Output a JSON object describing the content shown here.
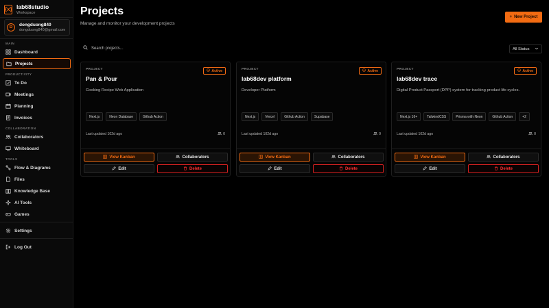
{
  "brand": {
    "logo": "{x}",
    "name": "lab68studio",
    "subtitle": "Workspace"
  },
  "user": {
    "initial": "D",
    "name": "dongduong840",
    "email": "dongduong840@gmail.com"
  },
  "sidebar": {
    "sections": {
      "main": "MAIN",
      "productivity": "PRODUCTIVITY",
      "collaboration": "COLLABORATION",
      "tools": "TOOLS"
    },
    "items": [
      {
        "label": "Dashboard",
        "icon": "grid-icon"
      },
      {
        "label": "Projects",
        "icon": "folder-icon",
        "active": true
      },
      {
        "label": "To Do",
        "icon": "checkbox-icon"
      },
      {
        "label": "Meetings",
        "icon": "video-icon"
      },
      {
        "label": "Planning",
        "icon": "calendar-icon"
      },
      {
        "label": "Invoices",
        "icon": "invoice-icon"
      },
      {
        "label": "Collaborators",
        "icon": "users-icon"
      },
      {
        "label": "Whiteboard",
        "icon": "whiteboard-icon"
      },
      {
        "label": "Flow & Diagrams",
        "icon": "flow-icon"
      },
      {
        "label": "Files",
        "icon": "file-icon"
      },
      {
        "label": "Knowledge Base",
        "icon": "book-icon"
      },
      {
        "label": "AI Tools",
        "icon": "ai-icon"
      },
      {
        "label": "Games",
        "icon": "gamepad-icon"
      },
      {
        "label": "Settings",
        "icon": "gear-icon"
      },
      {
        "label": "Log Out",
        "icon": "logout-icon"
      }
    ]
  },
  "header": {
    "title": "Projects",
    "subtitle": "Manage and monitor your development projects",
    "new_button": "New Project",
    "new_icon": "+"
  },
  "filters": {
    "search_placeholder": "Search projects...",
    "status_value": "All Status"
  },
  "colors": {
    "accent": "#f26b12",
    "danger": "#d42020",
    "background": "#000000"
  },
  "projects": [
    {
      "kind": "PROJECT",
      "name": "Pan & Pour",
      "status": "Active",
      "description": "Cooking Recipe Web Application",
      "tags": [
        "Next.js",
        "Neon Database",
        "Github Action"
      ],
      "updated": "Last updated 102d ago",
      "collaborators": "0",
      "actions": {
        "kanban": "View Kanban",
        "collaborators": "Collaborators",
        "edit": "Edit",
        "delete": "Delete"
      }
    },
    {
      "kind": "PROJECT",
      "name": "lab68dev platform",
      "status": "Active",
      "description": "Developer Platform",
      "tags": [
        "Next.js",
        "Vercel",
        "Github Action",
        "Supabase"
      ],
      "updated": "Last updated 102d ago",
      "collaborators": "0",
      "actions": {
        "kanban": "View Kanban",
        "collaborators": "Collaborators",
        "edit": "Edit",
        "delete": "Delete"
      }
    },
    {
      "kind": "PROJECT",
      "name": "lab68dev trace",
      "status": "Active",
      "description": "Digital Product Passport (DPP) system for tracking product life cycles.",
      "tags": [
        "Next.js 16+",
        "TailwindCSS",
        "Prisma with Neon",
        "Github Action",
        "+2"
      ],
      "updated": "Last updated 102d ago",
      "collaborators": "0",
      "actions": {
        "kanban": "View Kanban",
        "collaborators": "Collaborators",
        "edit": "Edit",
        "delete": "Delete"
      }
    }
  ]
}
